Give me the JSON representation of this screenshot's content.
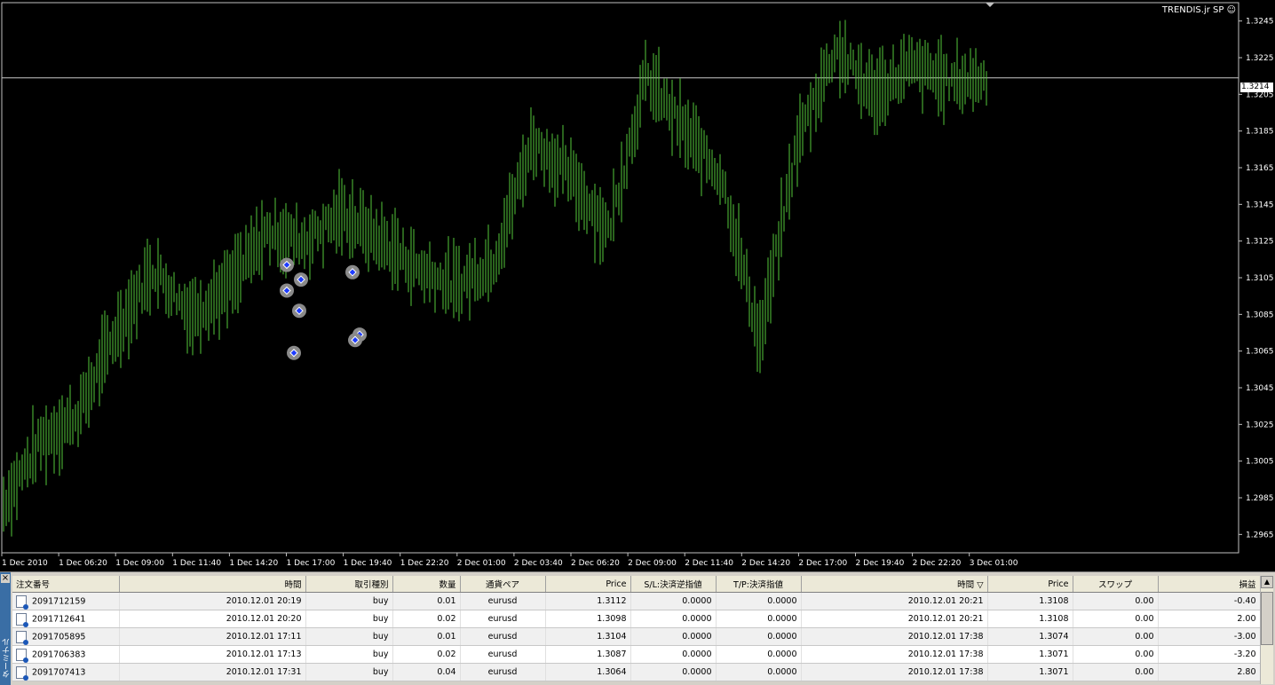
{
  "chart": {
    "symbol_label": "TRENDIS.jr SP ☺",
    "current_price": "1.3214",
    "y_ticks": [
      "1.3245",
      "1.3225",
      "1.3205",
      "1.3185",
      "1.3165",
      "1.3145",
      "1.3125",
      "1.3105",
      "1.3085",
      "1.3065",
      "1.3045",
      "1.3025",
      "1.3005",
      "1.2985",
      "1.2965"
    ],
    "x_ticks": [
      "1 Dec 2010",
      "1 Dec 06:20",
      "1 Dec 09:00",
      "1 Dec 11:40",
      "1 Dec 14:20",
      "1 Dec 17:00",
      "1 Dec 19:40",
      "1 Dec 22:20",
      "2 Dec 01:00",
      "2 Dec 03:40",
      "2 Dec 06:20",
      "2 Dec 09:00",
      "2 Dec 11:40",
      "2 Dec 14:20",
      "2 Dec 17:00",
      "2 Dec 19:40",
      "2 Dec 22:20",
      "3 Dec 01:00"
    ],
    "colors": {
      "background": "#000000",
      "bars": "#55c83a",
      "grid_text": "#ffffff",
      "marker": "#1e3cff"
    }
  },
  "chart_data": {
    "type": "bar",
    "title": "",
    "ylim": [
      1.2955,
      1.3255
    ],
    "current_price": 1.3214,
    "x": [
      "1 Dec 2010",
      "1 Dec 06:20",
      "1 Dec 09:00",
      "1 Dec 11:40",
      "1 Dec 14:20",
      "1 Dec 17:00",
      "1 Dec 19:40",
      "1 Dec 22:20",
      "2 Dec 01:00",
      "2 Dec 03:40",
      "2 Dec 06:20",
      "2 Dec 09:00",
      "2 Dec 11:40",
      "2 Dec 14:20",
      "2 Dec 17:00",
      "2 Dec 19:40",
      "2 Dec 22:20",
      "3 Dec 01:00"
    ],
    "series": [
      {
        "values": [
          1.298,
          1.3015,
          1.303,
          1.3075,
          1.311,
          1.3085,
          1.31,
          1.313,
          1.3125,
          1.314,
          1.3125,
          1.311,
          1.31,
          1.3115,
          1.318,
          1.316,
          1.313,
          1.3215,
          1.3185,
          1.316,
          1.307,
          1.318,
          1.323,
          1.3205,
          1.322,
          1.3212,
          1.3214
        ]
      }
    ],
    "trade_markers": [
      1.3112,
      1.3098,
      1.3104,
      1.3087,
      1.3064,
      1.3108,
      1.3074,
      1.3071
    ]
  },
  "orders": {
    "columns": [
      "注文番号",
      "時間",
      "取引種別",
      "数量",
      "通貨ペア",
      "Price",
      "S/L:決済逆指値",
      "T/P:決済指値",
      "時間",
      "Price",
      "スワップ",
      "損益"
    ],
    "sort_indicator": "▽",
    "rows": [
      [
        "2091712159",
        "2010.12.01 20:19",
        "buy",
        "0.01",
        "eurusd",
        "1.3112",
        "0.0000",
        "0.0000",
        "2010.12.01 20:21",
        "1.3108",
        "0.00",
        "-0.40"
      ],
      [
        "2091712641",
        "2010.12.01 20:20",
        "buy",
        "0.02",
        "eurusd",
        "1.3098",
        "0.0000",
        "0.0000",
        "2010.12.01 20:21",
        "1.3108",
        "0.00",
        "2.00"
      ],
      [
        "2091705895",
        "2010.12.01 17:11",
        "buy",
        "0.01",
        "eurusd",
        "1.3104",
        "0.0000",
        "0.0000",
        "2010.12.01 17:38",
        "1.3074",
        "0.00",
        "-3.00"
      ],
      [
        "2091706383",
        "2010.12.01 17:13",
        "buy",
        "0.02",
        "eurusd",
        "1.3087",
        "0.0000",
        "0.0000",
        "2010.12.01 17:38",
        "1.3071",
        "0.00",
        "-3.20"
      ],
      [
        "2091707413",
        "2010.12.01 17:31",
        "buy",
        "0.04",
        "eurusd",
        "1.3064",
        "0.0000",
        "0.0000",
        "2010.12.01 17:38",
        "1.3071",
        "0.00",
        "2.80"
      ]
    ]
  },
  "terminal": {
    "close_glyph": "×",
    "tab_label": "ターミナル"
  }
}
